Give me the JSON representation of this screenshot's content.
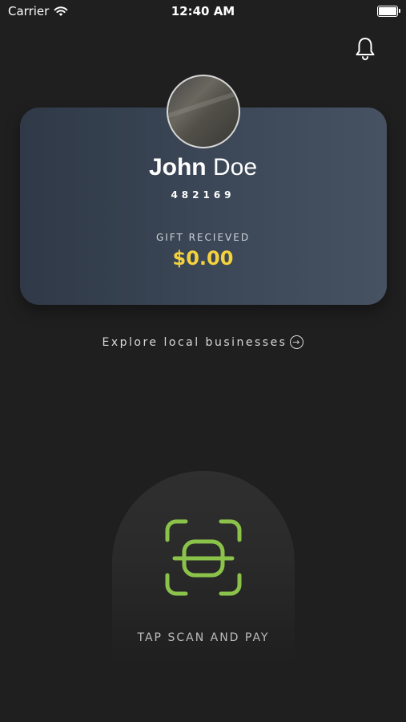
{
  "status_bar": {
    "carrier": "Carrier",
    "time": "12:40 AM"
  },
  "icons": {
    "wifi": "wifi-icon",
    "battery": "battery-icon",
    "notifications": "bell-icon",
    "explore_arrow": "arrow-right-circle-icon",
    "scan": "scan-icon"
  },
  "profile": {
    "first_name": "John",
    "last_name": " Doe",
    "user_id": "482169",
    "gift_label": "GIFT RECIEVED",
    "gift_amount": "$0.00"
  },
  "explore": {
    "label": "Explore local businesses"
  },
  "scan": {
    "label": "TAP SCAN AND PAY"
  },
  "colors": {
    "background": "#1f1f1f",
    "accent_gold": "#f4d23e",
    "scan_green": "#8bc34a"
  }
}
